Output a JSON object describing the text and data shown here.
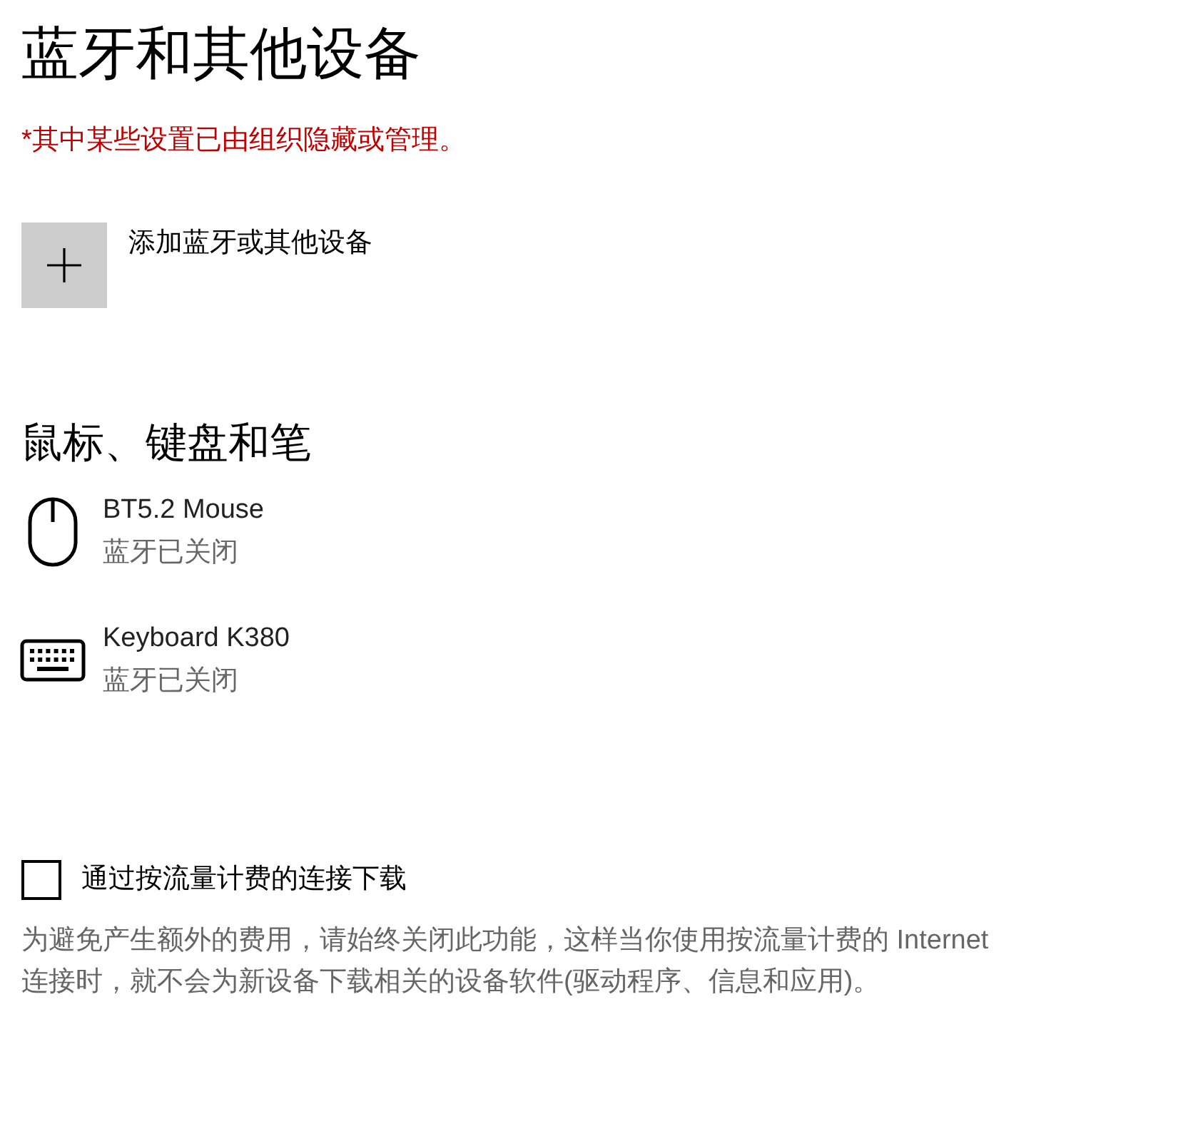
{
  "title": "蓝牙和其他设备",
  "notice": "*其中某些设置已由组织隐藏或管理。",
  "add_device": {
    "label": "添加蓝牙或其他设备"
  },
  "section": {
    "heading": "鼠标、键盘和笔",
    "devices": [
      {
        "kind": "mouse",
        "name": "BT5.2 Mouse",
        "status": "蓝牙已关闭"
      },
      {
        "kind": "keyboard",
        "name": "Keyboard K380",
        "status": "蓝牙已关闭"
      }
    ]
  },
  "metered": {
    "checked": false,
    "label": "通过按流量计费的连接下载"
  },
  "description": "为避免产生额外的费用，请始终关闭此功能，这样当你使用按流量计费的 Internet 连接时，就不会为新设备下载相关的设备软件(驱动程序、信息和应用)。"
}
